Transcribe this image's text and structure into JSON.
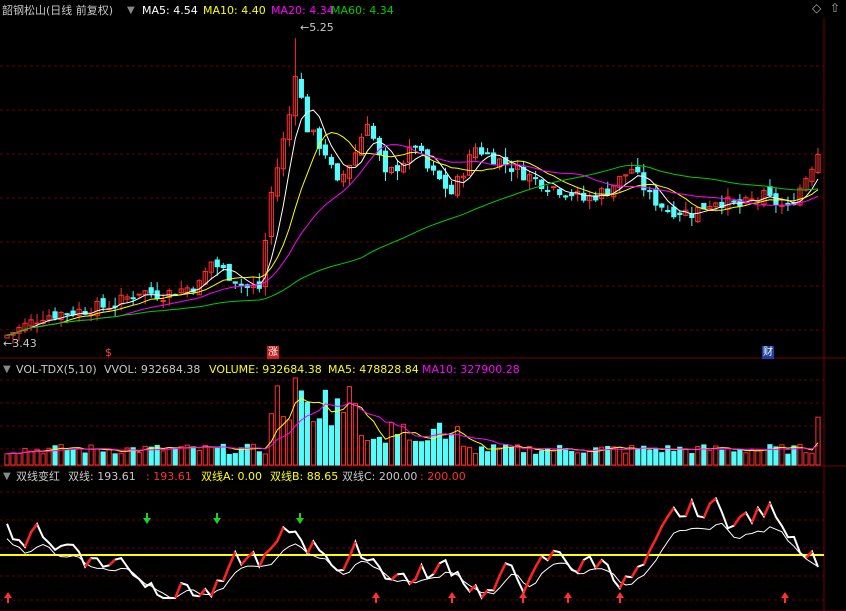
{
  "main_panel": {
    "title": "韶钢松山(日线 前复权)",
    "ma5": "MA5: 4.54",
    "ma10": "MA10: 4.40",
    "ma20": "MA20: 4.34",
    "ma60": "MA60: 4.34",
    "high_marker": "5.25",
    "low_marker": "3.43",
    "event_marks": [
      "$",
      "涨",
      "财"
    ],
    "colors": {
      "ma5": "#ffffff",
      "ma10": "#ffff00",
      "ma20": "#ff00ff",
      "ma60": "#00cc00",
      "up": "#ff3030",
      "down": "#54fcfc"
    }
  },
  "volume_panel": {
    "indicator": "VOL-TDX(5,10)",
    "vvol": "VVOL: 932684.38",
    "volume": "VOLUME: 932684.38",
    "ma5": "MA5: 478828.84",
    "ma10": "MA10: 327900.28"
  },
  "osc_panel": {
    "name": "双线变红",
    "line1_label": "双线: 193.61",
    "line1_value": "193.61",
    "a": "双线A: 0.00",
    "b": "双线B: 88.65",
    "c": "双线C: 200.00",
    "c_value": "200.00"
  },
  "toolbar_icons": [
    "collapse-triangle-icon",
    "diamond-icon",
    "up-arrow-icon"
  ],
  "chart_data": [
    {
      "type": "candlestick",
      "title": "韶钢松山(日线 前复权)",
      "price_high": 5.25,
      "price_low": 3.43,
      "series": [
        {
          "name": "MA5",
          "last": 4.54
        },
        {
          "name": "MA10",
          "last": 4.4
        },
        {
          "name": "MA20",
          "last": 4.34
        },
        {
          "name": "MA60",
          "last": 4.34
        }
      ],
      "ylim": [
        3.4,
        5.3
      ]
    },
    {
      "type": "bar",
      "title": "VOL-TDX(5,10)",
      "series": [
        {
          "name": "VOLUME",
          "last": 932684.38
        },
        {
          "name": "MA5",
          "last": 478828.84
        },
        {
          "name": "MA10",
          "last": 327900.28
        }
      ]
    },
    {
      "type": "line",
      "title": "双线变红",
      "series": [
        {
          "name": "双线",
          "last": 193.61
        },
        {
          "name": "双线A",
          "last": 0.0
        },
        {
          "name": "双线B",
          "last": 88.65
        },
        {
          "name": "双线C",
          "last": 200.0
        }
      ]
    }
  ]
}
